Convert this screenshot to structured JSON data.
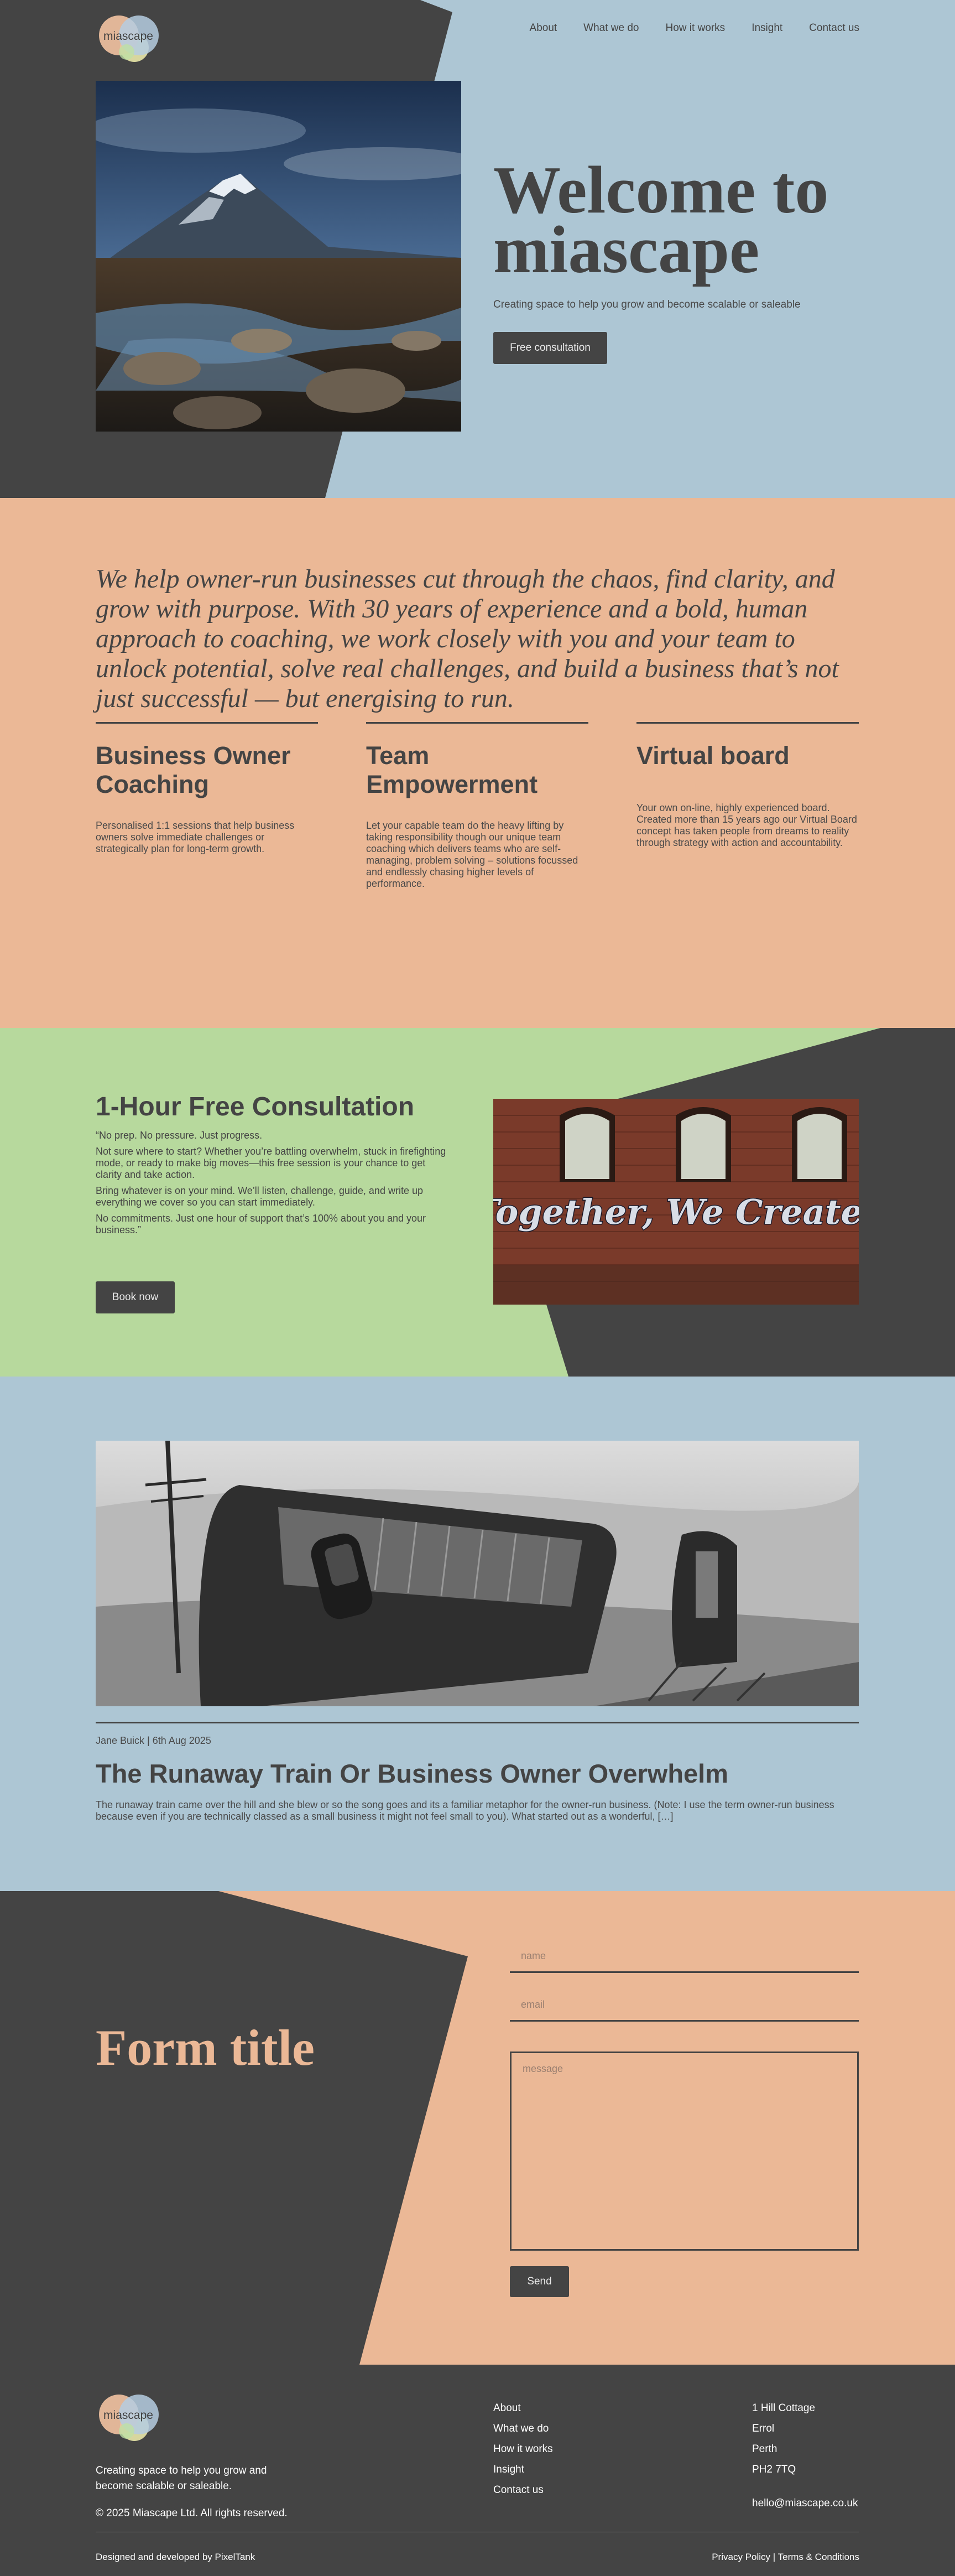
{
  "brand": {
    "name": "miascape",
    "colors": {
      "dark": "#444444",
      "blue": "#adc6d4",
      "peach": "#ebb896",
      "green": "#b7d99d"
    }
  },
  "nav": {
    "items": [
      "About",
      "What we do",
      "How it works",
      "Insight",
      "Contact us"
    ]
  },
  "hero": {
    "title_line1": "Welcome to",
    "title_line2": "miascape",
    "subtitle": "Creating space to help you grow and become scalable or saleable",
    "cta": "Free consultation"
  },
  "intro": {
    "quote": "We help owner-run businesses cut through the chaos, find clarity, and grow with purpose. With 30 years of experience and a bold, human approach to coaching, we work closely with you and your team to unlock potential, solve real challenges, and build a business that’s not just successful — but energising to run."
  },
  "services": [
    {
      "title": "Business Owner Coaching",
      "text": "Personalised 1:1 sessions that help business owners solve immediate challenges or strategically plan for long-term growth."
    },
    {
      "title": "Team Empowerment",
      "text": "Let your capable team do the heavy lifting by taking responsibility though our unique team coaching which delivers teams who are self-managing, problem solving – solutions focussed and endlessly chasing higher levels of performance."
    },
    {
      "title": "Virtual board",
      "text": "Your own on-line, highly experienced board. Created more than 15 years ago our Virtual Board concept has taken people from dreams to reality through strategy with action and accountability."
    }
  ],
  "consultation": {
    "title": "1-Hour Free Consultation",
    "p1": "“No prep. No pressure. Just progress.",
    "p2": "Not sure where to start? Whether you’re battling overwhelm, stuck in firefighting mode, or ready to make big moves—this free session is your chance to get clarity and take action.",
    "p3": "Bring whatever is on your mind. We’ll listen, challenge, guide, and write up everything we cover so you can start immediately.",
    "p4": "No commitments. Just one hour of support that’s 100% about you and your business.”",
    "cta": "Book now",
    "image_text": "Together, We Create!"
  },
  "blog": {
    "meta": "Jane Buick | 6th Aug 2025",
    "title": "The Runaway Train Or Business Owner Overwhelm",
    "excerpt": "The runaway train came over the hill and she blew or so the song goes and its a familiar metaphor for the owner-run business. (Note: I use the term owner-run business because even if you are technically classed as a small business it might not feel small to you). What started out as a wonderful, […]"
  },
  "contact": {
    "title": "Form title",
    "name_placeholder": "name",
    "email_placeholder": "email",
    "message_placeholder": "message",
    "submit": "Send"
  },
  "footer": {
    "tagline": "Creating space to help you grow and become scalable or saleable.",
    "copyright": "© 2025 Miascape Ltd. All rights reserved.",
    "links": [
      "About",
      "What we do",
      "How it works",
      "Insight",
      "Contact us"
    ],
    "address": [
      "1 Hill Cottage",
      "Errol",
      "Perth",
      "PH2 7TQ"
    ],
    "email": "hello@miascape.co.uk",
    "credit": "Designed and developed by PixelTank",
    "privacy": "Privacy Policy",
    "separator": "|",
    "terms": "Terms & Conditions"
  }
}
